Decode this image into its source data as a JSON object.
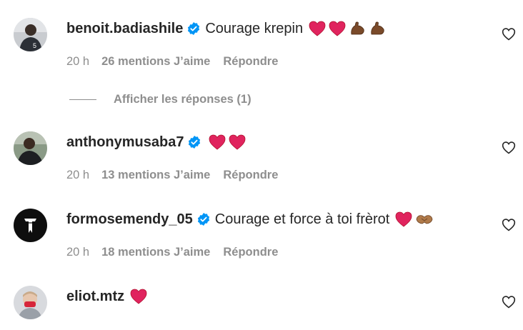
{
  "comments": [
    {
      "username": "benoit.badiashile",
      "text": "Courage krepin",
      "emojis": [
        "red-heart",
        "red-heart",
        "flexed-biceps",
        "flexed-biceps"
      ],
      "time": "20 h",
      "likes": "26 mentions J’aime",
      "reply": "Répondre",
      "verified": true
    },
    {
      "username": "anthonymusaba7",
      "text": "",
      "emojis": [
        "red-heart",
        "red-heart"
      ],
      "time": "20 h",
      "likes": "13 mentions J’aime",
      "reply": "Répondre",
      "verified": true
    },
    {
      "username": "formosemendy_05",
      "text": "Courage et force à toi frèrot",
      "emojis": [
        "red-heart",
        "handshake"
      ],
      "time": "20 h",
      "likes": "18 mentions J’aime",
      "reply": "Répondre",
      "verified": true
    },
    {
      "username": "eliot.mtz",
      "text": "",
      "emojis": [
        "red-heart"
      ],
      "verified": false
    }
  ],
  "view_replies": "Afficher les réponses (1)",
  "colors": {
    "text": "#262626",
    "secondary": "#8e8e8e",
    "verified": "#0095f6",
    "heart": "#e0245e"
  }
}
